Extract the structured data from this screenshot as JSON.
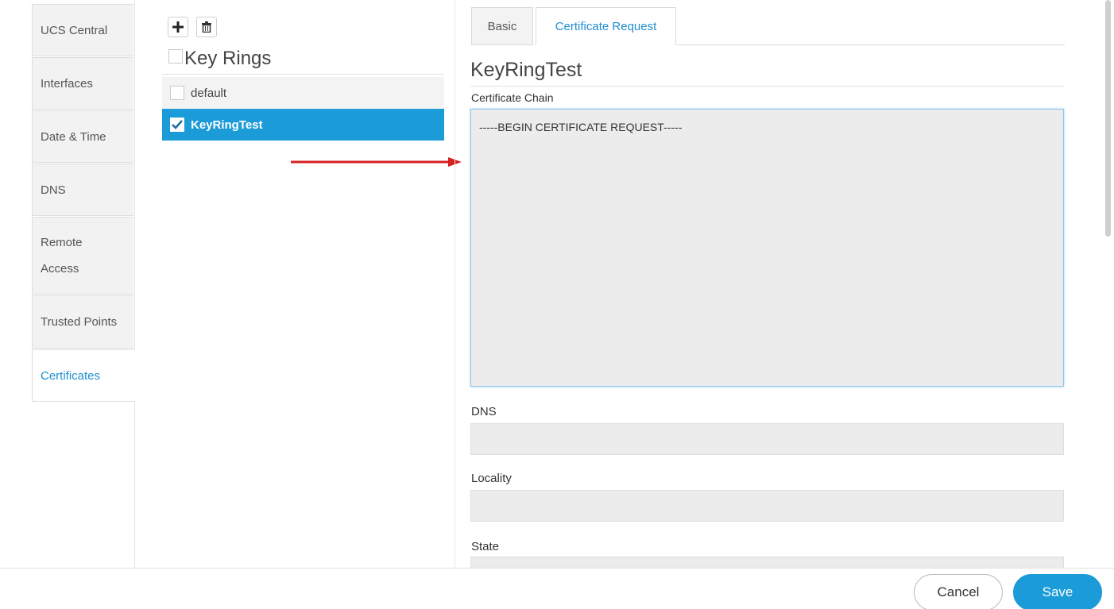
{
  "nav": {
    "items": [
      {
        "label": "UCS Central"
      },
      {
        "label": "Interfaces"
      },
      {
        "label": "Date & Time"
      },
      {
        "label": "DNS"
      },
      {
        "label": "Remote\nAccess"
      },
      {
        "label": "Trusted Points"
      },
      {
        "label": "Certificates"
      }
    ],
    "active": "Certificates"
  },
  "keyrings": {
    "title": "Key Rings",
    "toolbar": {
      "add_icon": "plus-icon",
      "delete_icon": "trash-icon"
    },
    "items": [
      {
        "label": "default",
        "checked": false
      },
      {
        "label": "KeyRingTest",
        "checked": true
      }
    ]
  },
  "tabs": [
    {
      "label": "Basic"
    },
    {
      "label": "Certificate Request"
    }
  ],
  "active_tab": "Certificate Request",
  "detail": {
    "name": "KeyRingTest",
    "cert_chain_label": "Certificate Chain",
    "cert_chain_value": "-----BEGIN CERTIFICATE REQUEST-----",
    "dns_label": "DNS",
    "dns_value": "",
    "locality_label": "Locality",
    "locality_value": "",
    "state_label": "State",
    "state_value": ""
  },
  "footer": {
    "cancel_label": "Cancel",
    "save_label": "Save"
  },
  "colors": {
    "accent": "#1b9bd7",
    "arrow": "#d62020"
  }
}
